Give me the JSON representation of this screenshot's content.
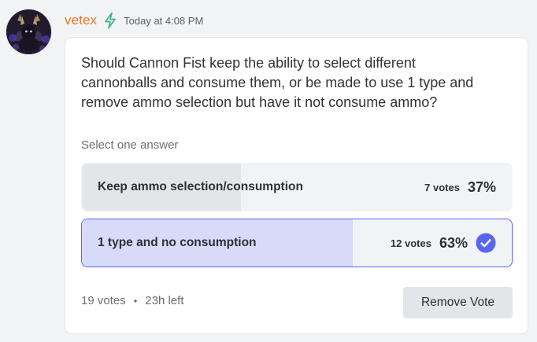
{
  "message": {
    "username": "vetex",
    "username_color": "#e07a2e",
    "badge_icon": "lightning-bolt-icon",
    "timestamp": "Today at 4:08 PM"
  },
  "poll": {
    "question": "Should Cannon Fist keep the ability to select different cannonballs and consume them, or be made to use 1 type and remove ammo selection but have it not consume ammo?",
    "subtitle": "Select one answer",
    "answers": [
      {
        "label": "Keep ammo selection/consumption",
        "votes": "7 votes",
        "percent": "37%",
        "fill_fraction": 0.37,
        "selected": false
      },
      {
        "label": "1 type and no consumption",
        "votes": "12 votes",
        "percent": "63%",
        "fill_fraction": 0.63,
        "selected": true
      }
    ],
    "total_votes": "19 votes",
    "separator": "•",
    "time_left": "23h left",
    "remove_vote_label": "Remove Vote",
    "accent_color": "#5865f2"
  }
}
